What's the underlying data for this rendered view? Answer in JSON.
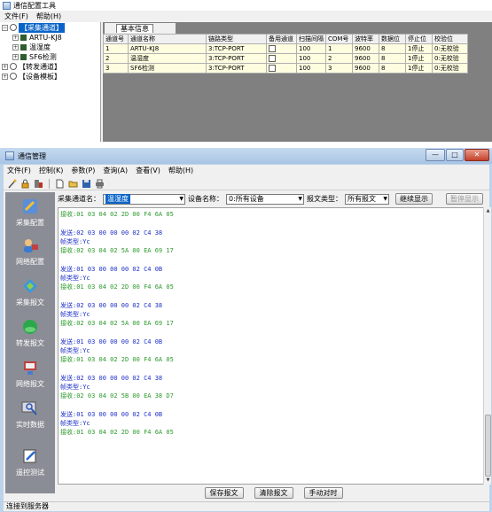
{
  "config_window": {
    "title": "通信配置工具",
    "menu": [
      "文件(F)",
      "帮助(H)"
    ],
    "tree": {
      "root_acquisition": "【采集通道】",
      "channels": [
        "ARTU-KJ8",
        "温湿度",
        "SF6检测"
      ],
      "root_forward": "【转发通道】",
      "root_device_template": "【设备模板】",
      "expand_glyph": "+",
      "collapse_glyph": "−"
    },
    "tab_label": "基本信息",
    "grid": {
      "headers": [
        "通道号",
        "通道名称",
        "链路类型",
        "备用通道",
        "扫描间隔",
        "COM号",
        "波特率",
        "数据位",
        "停止位",
        "校验位"
      ],
      "rows": [
        [
          "1",
          "ARTU-KJ8",
          "3:TCP-PORT",
          "",
          "100",
          "1",
          "9600",
          "8",
          "1停止",
          "0:无校验"
        ],
        [
          "2",
          "温湿度",
          "3:TCP-PORT",
          "",
          "100",
          "2",
          "9600",
          "8",
          "1停止",
          "0:无校验"
        ],
        [
          "3",
          "SF6检测",
          "3:TCP-PORT",
          "",
          "100",
          "3",
          "9600",
          "8",
          "1停止",
          "0:无校验"
        ]
      ]
    }
  },
  "comm_window": {
    "title": "通信管理",
    "caption_buttons": {
      "minimize": "—",
      "maximize": "□",
      "close": "✕"
    },
    "menu": [
      "文件(F)",
      "控制(K)",
      "参数(P)",
      "查询(A)",
      "查看(V)",
      "帮助(H)"
    ],
    "sidebar": [
      "采集配置",
      "网络配置",
      "采集报文",
      "转发报文",
      "网络报文",
      "实时数据",
      "遥控测试"
    ],
    "filter": {
      "channel_label": "采集通道名：",
      "channel_value": "温湿度",
      "device_label": "设备名称：",
      "device_value": "0:所有设备",
      "msg_type_label": "报文类型：",
      "msg_type_value": "所有报文",
      "continue_button": "继续显示",
      "pause_button": "暂停显示"
    },
    "log_lines": [
      {
        "kind": "recv",
        "text": "接收:01 03 04 02 2D 00 F4 6A 05"
      },
      {
        "kind": "blank",
        "text": ""
      },
      {
        "kind": "send",
        "text": "发送:02 03 00 00 00 02 C4 38"
      },
      {
        "kind": "type",
        "text": "帧类型:Yc"
      },
      {
        "kind": "recv",
        "text": "接收:02 03 04 02 5A 00 EA 69 17"
      },
      {
        "kind": "blank",
        "text": ""
      },
      {
        "kind": "send",
        "text": "发送:01 03 00 00 00 02 C4 0B"
      },
      {
        "kind": "type",
        "text": "帧类型:Yc"
      },
      {
        "kind": "recv",
        "text": "接收:01 03 04 02 2D 00 F4 6A 05"
      },
      {
        "kind": "blank",
        "text": ""
      },
      {
        "kind": "send",
        "text": "发送:02 03 00 00 00 02 C4 38"
      },
      {
        "kind": "type",
        "text": "帧类型:Yc"
      },
      {
        "kind": "recv",
        "text": "接收:02 03 04 02 5A 00 EA 69 17"
      },
      {
        "kind": "blank",
        "text": ""
      },
      {
        "kind": "send",
        "text": "发送:01 03 00 00 00 02 C4 0B"
      },
      {
        "kind": "type",
        "text": "帧类型:Yc"
      },
      {
        "kind": "recv",
        "text": "接收:01 03 04 02 2D 00 F4 6A 05"
      },
      {
        "kind": "blank",
        "text": ""
      },
      {
        "kind": "send",
        "text": "发送:02 03 00 00 00 02 C4 38"
      },
      {
        "kind": "type",
        "text": "帧类型:Yc"
      },
      {
        "kind": "recv",
        "text": "接收:02 03 04 02 5B 00 EA 38 D7"
      },
      {
        "kind": "blank",
        "text": ""
      },
      {
        "kind": "send",
        "text": "发送:01 03 00 00 00 02 C4 0B"
      },
      {
        "kind": "type",
        "text": "帧类型:Yc"
      },
      {
        "kind": "recv",
        "text": "接收:01 03 04 02 2D 00 F4 6A 05"
      }
    ],
    "bottom_buttons": [
      "保存报文",
      "清除报文",
      "手动对时"
    ],
    "status": "连接到服务器"
  },
  "colors": {
    "send": "#1c2fc8",
    "recv": "#2a9a2a",
    "tree_selected": "#0a64c8",
    "sidebar_bg": "#8a8d95",
    "grid_row": "#fffde0"
  }
}
